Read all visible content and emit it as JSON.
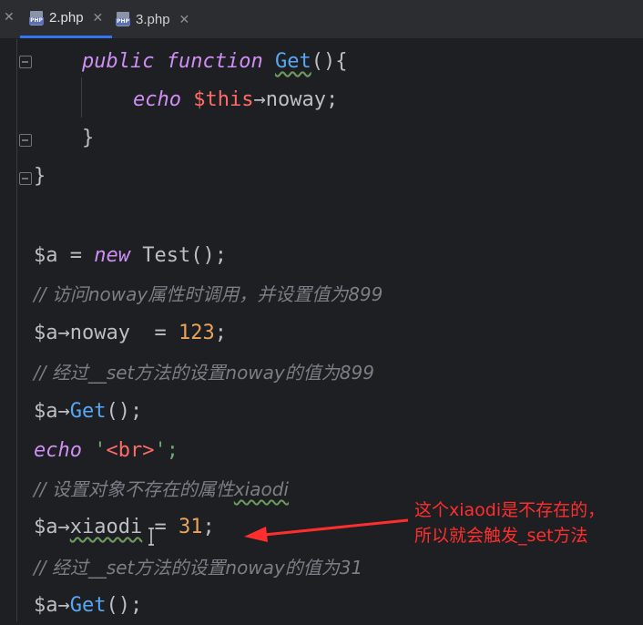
{
  "tabs": [
    {
      "label": "2.php",
      "active": true,
      "icon": "php-file-icon"
    },
    {
      "label": "3.php",
      "active": false,
      "icon": "php-file-icon"
    }
  ],
  "code": {
    "l1": {
      "kw1": "public",
      "kw2": "function",
      "fn": "Get",
      "rest": "(){"
    },
    "l2": {
      "kw": "echo",
      "this": "$this",
      "arrow": "→",
      "prop": "noway;"
    },
    "l3": "}",
    "l4": "}",
    "l5": {
      "var": "$a",
      "eq": " = ",
      "kw": "new",
      "cls": " Test",
      "rest": "();"
    },
    "l6": "// 访问noway属性时调用，并设置值为899",
    "l7": {
      "var": "$a",
      "arrow": "→",
      "prop": "noway  = ",
      "num": "123",
      "semi": ";"
    },
    "l8": "// 经过__set方法的设置noway的值为899",
    "l9": {
      "var": "$a",
      "arrow": "→",
      "fn": "Get",
      "rest": "();"
    },
    "l10": {
      "kw": "echo",
      "q1": " '",
      "tag": "<br>",
      "q2": "';"
    },
    "l11": {
      "text": "// 设置对象不存在的属性",
      "wavy": "xiaodi"
    },
    "l12": {
      "var": "$a",
      "arrow": "→",
      "prop": "xiaodi",
      "eq": " = ",
      "num": "31",
      "semi": ";"
    },
    "l13": "// 经过__set方法的设置noway的值为31",
    "l14": {
      "var": "$a",
      "arrow": "→",
      "fn": "Get",
      "rest": "();"
    }
  },
  "annotation": {
    "line1": "这个xiaodi是不存在的，",
    "line2": "所以就会触发_set方法",
    "color": "#ff2e2e"
  }
}
